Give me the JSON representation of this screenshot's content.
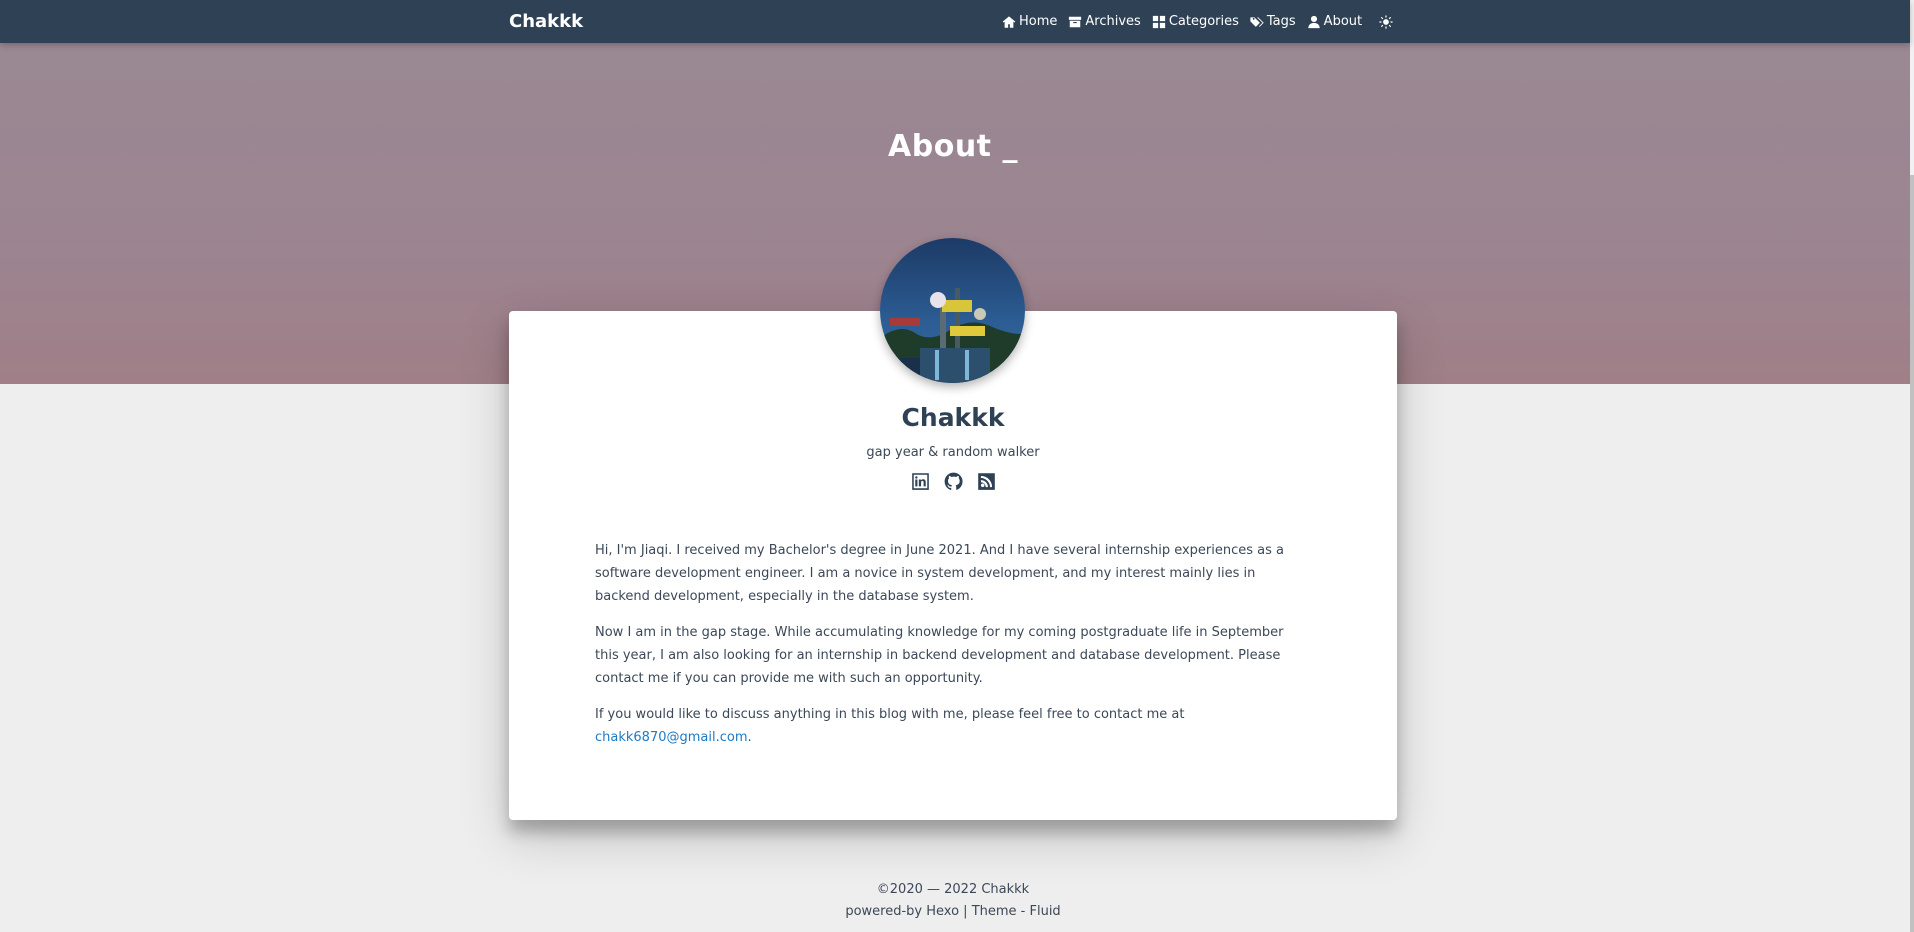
{
  "navbar": {
    "brand": "Chakkk",
    "items": [
      {
        "label": "Home",
        "icon": "home-icon"
      },
      {
        "label": "Archives",
        "icon": "archive-icon"
      },
      {
        "label": "Categories",
        "icon": "grid-icon"
      },
      {
        "label": "Tags",
        "icon": "tags-icon"
      },
      {
        "label": "About",
        "icon": "user-icon"
      }
    ],
    "theme_icon": "sun-icon"
  },
  "banner": {
    "title": "About _"
  },
  "profile": {
    "name": "Chakkk",
    "intro": "gap year & random walker",
    "social_icons": [
      "linkedin-icon",
      "github-icon",
      "rss-icon"
    ]
  },
  "content": {
    "paragraph_1": "Hi, I'm Jiaqi. I received my Bachelor's degree in June 2021. And I have several internship experiences as a software development engineer. I am a novice in system development, and my interest mainly lies in backend development, especially in the database system.",
    "paragraph_2": "Now I am in the gap stage. While accumulating knowledge for my coming postgraduate life in September this year, I am also looking for an internship in backend development and database development. Please contact me if you can provide me with such an opportunity.",
    "paragraph_3_text": "If you would like to discuss anything in this blog with me, please feel free to contact me at ",
    "email": "chakk6870@gmail.com",
    "paragraph_3_end": "."
  },
  "footer": {
    "copyright": "©2020 — 2022 Chakkk",
    "powered_prefix": "powered-by ",
    "hexo": "Hexo",
    "separator": " | ",
    "theme_prefix": "Theme - ",
    "fluid": "Fluid"
  },
  "colors": {
    "navbar_bg": "#2f4154",
    "banner_bg": "#9b8591",
    "page_bg": "#eeeeee",
    "link": "#1e7ac6"
  }
}
